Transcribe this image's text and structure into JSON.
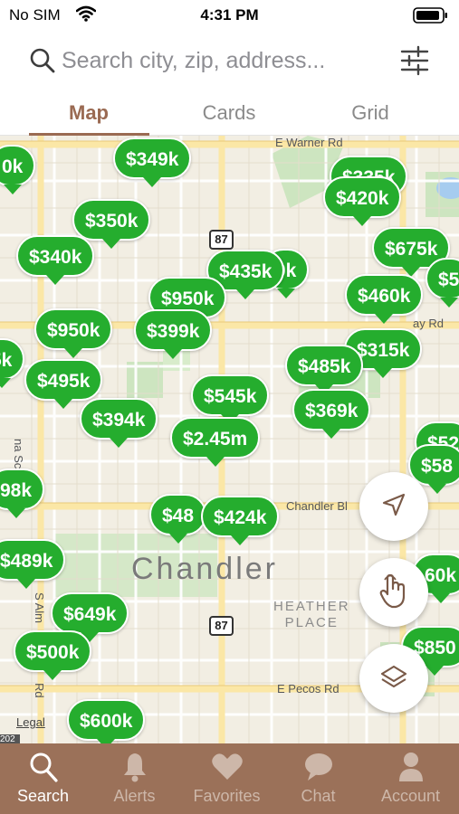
{
  "status_bar": {
    "carrier": "No SIM",
    "time": "4:31 PM"
  },
  "search": {
    "placeholder": "Search city, zip, address..."
  },
  "tabs": [
    {
      "label": "Map",
      "active": true
    },
    {
      "label": "Cards",
      "active": false
    },
    {
      "label": "Grid",
      "active": false
    }
  ],
  "map": {
    "city_label": "Chandler",
    "area_label_line1": "HEATHER",
    "area_label_line2": "PLACE",
    "streets": {
      "warner": "E Warner Rd",
      "ray": "ay Rd",
      "chandler_blvd": "Chandler Bl",
      "pecos": "E Pecos Rd",
      "school": "na School R",
      "alma": "S Alm",
      "rd": "Rd"
    },
    "route_shields": [
      "87",
      "87"
    ],
    "legal": "Legal",
    "edge_digits": "202",
    "listings": [
      {
        "price": "0k"
      },
      {
        "price": "$349k"
      },
      {
        "price": "$335k"
      },
      {
        "price": "$420k"
      },
      {
        "price": "$350k"
      },
      {
        "price": "$340k"
      },
      {
        "price": "$675k"
      },
      {
        "price": "$5"
      },
      {
        "price": "0k"
      },
      {
        "price": "$435k"
      },
      {
        "price": "$950k"
      },
      {
        "price": "$460k"
      },
      {
        "price": "$950k"
      },
      {
        "price": "$399k"
      },
      {
        "price": "5k"
      },
      {
        "price": "$315k"
      },
      {
        "price": "$495k"
      },
      {
        "price": "$485k"
      },
      {
        "price": "$545k"
      },
      {
        "price": "$394k"
      },
      {
        "price": "$369k"
      },
      {
        "price": "$2.45m"
      },
      {
        "price": "$52"
      },
      {
        "price": "$58"
      },
      {
        "price": "98k"
      },
      {
        "price": "$48"
      },
      {
        "price": "$424k"
      },
      {
        "price": "$489k"
      },
      {
        "price": "60k"
      },
      {
        "price": "$649k"
      },
      {
        "price": "$500k"
      },
      {
        "price": "$850"
      },
      {
        "price": "$600k"
      }
    ]
  },
  "bottom_nav": [
    {
      "label": "Search",
      "icon": "search-icon",
      "active": true
    },
    {
      "label": "Alerts",
      "icon": "bell-icon",
      "active": false
    },
    {
      "label": "Favorites",
      "icon": "heart-icon",
      "active": false
    },
    {
      "label": "Chat",
      "icon": "chat-icon",
      "active": false
    },
    {
      "label": "Account",
      "icon": "account-icon",
      "active": false
    }
  ],
  "colors": {
    "accent": "#9a6a52",
    "nav_background": "#9b7159",
    "pin_green": "#25ad2e",
    "map_background": "#f2eee3"
  }
}
